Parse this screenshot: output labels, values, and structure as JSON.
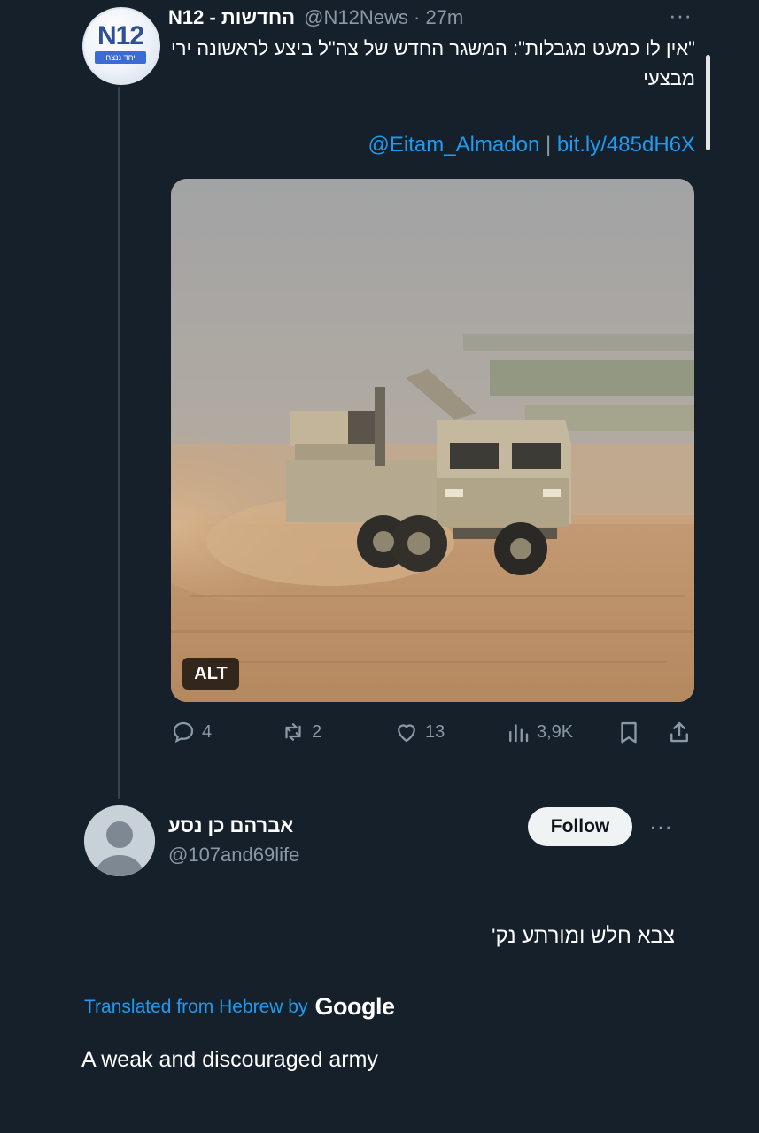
{
  "tweet": {
    "author_name": "N12 - החדשות",
    "handle": "@N12News",
    "separator": "·",
    "time": "27m",
    "more_label": "···",
    "avatar_logo": "N12",
    "avatar_subtext": "יחד ננצח",
    "text": "\"אין לו כמעט מגבלות\": המשגר החדש של צה\"ל ביצע לראשונה ירי מבצעי",
    "link_handle": "@Eitam_Almadon",
    "link_separator": "|",
    "link_url": "bit.ly/485dH6X",
    "media_alt_label": "ALT",
    "media_icon": "image-military-rocket-launcher-truck",
    "actions": {
      "reply": {
        "icon": "reply-icon",
        "count": "4"
      },
      "retweet": {
        "icon": "retweet-icon",
        "count": "2"
      },
      "like": {
        "icon": "heart-icon",
        "count": "13"
      },
      "views": {
        "icon": "views-icon",
        "count": "3,9K"
      },
      "bookmark": {
        "icon": "bookmark-icon"
      },
      "share": {
        "icon": "share-icon"
      }
    }
  },
  "reply": {
    "author_name": "אברהם כן נסע",
    "handle": "@107and69life",
    "follow_label": "Follow",
    "more_label": "···",
    "text": "צבא חלש ומורתע נק'",
    "translated_prefix": "Translated from Hebrew by",
    "translated_brand": "Google",
    "translation": "A weak and discouraged army"
  },
  "colors": {
    "background": "#15202b",
    "accent": "#1d9bf0",
    "muted": "#8b98a5"
  }
}
